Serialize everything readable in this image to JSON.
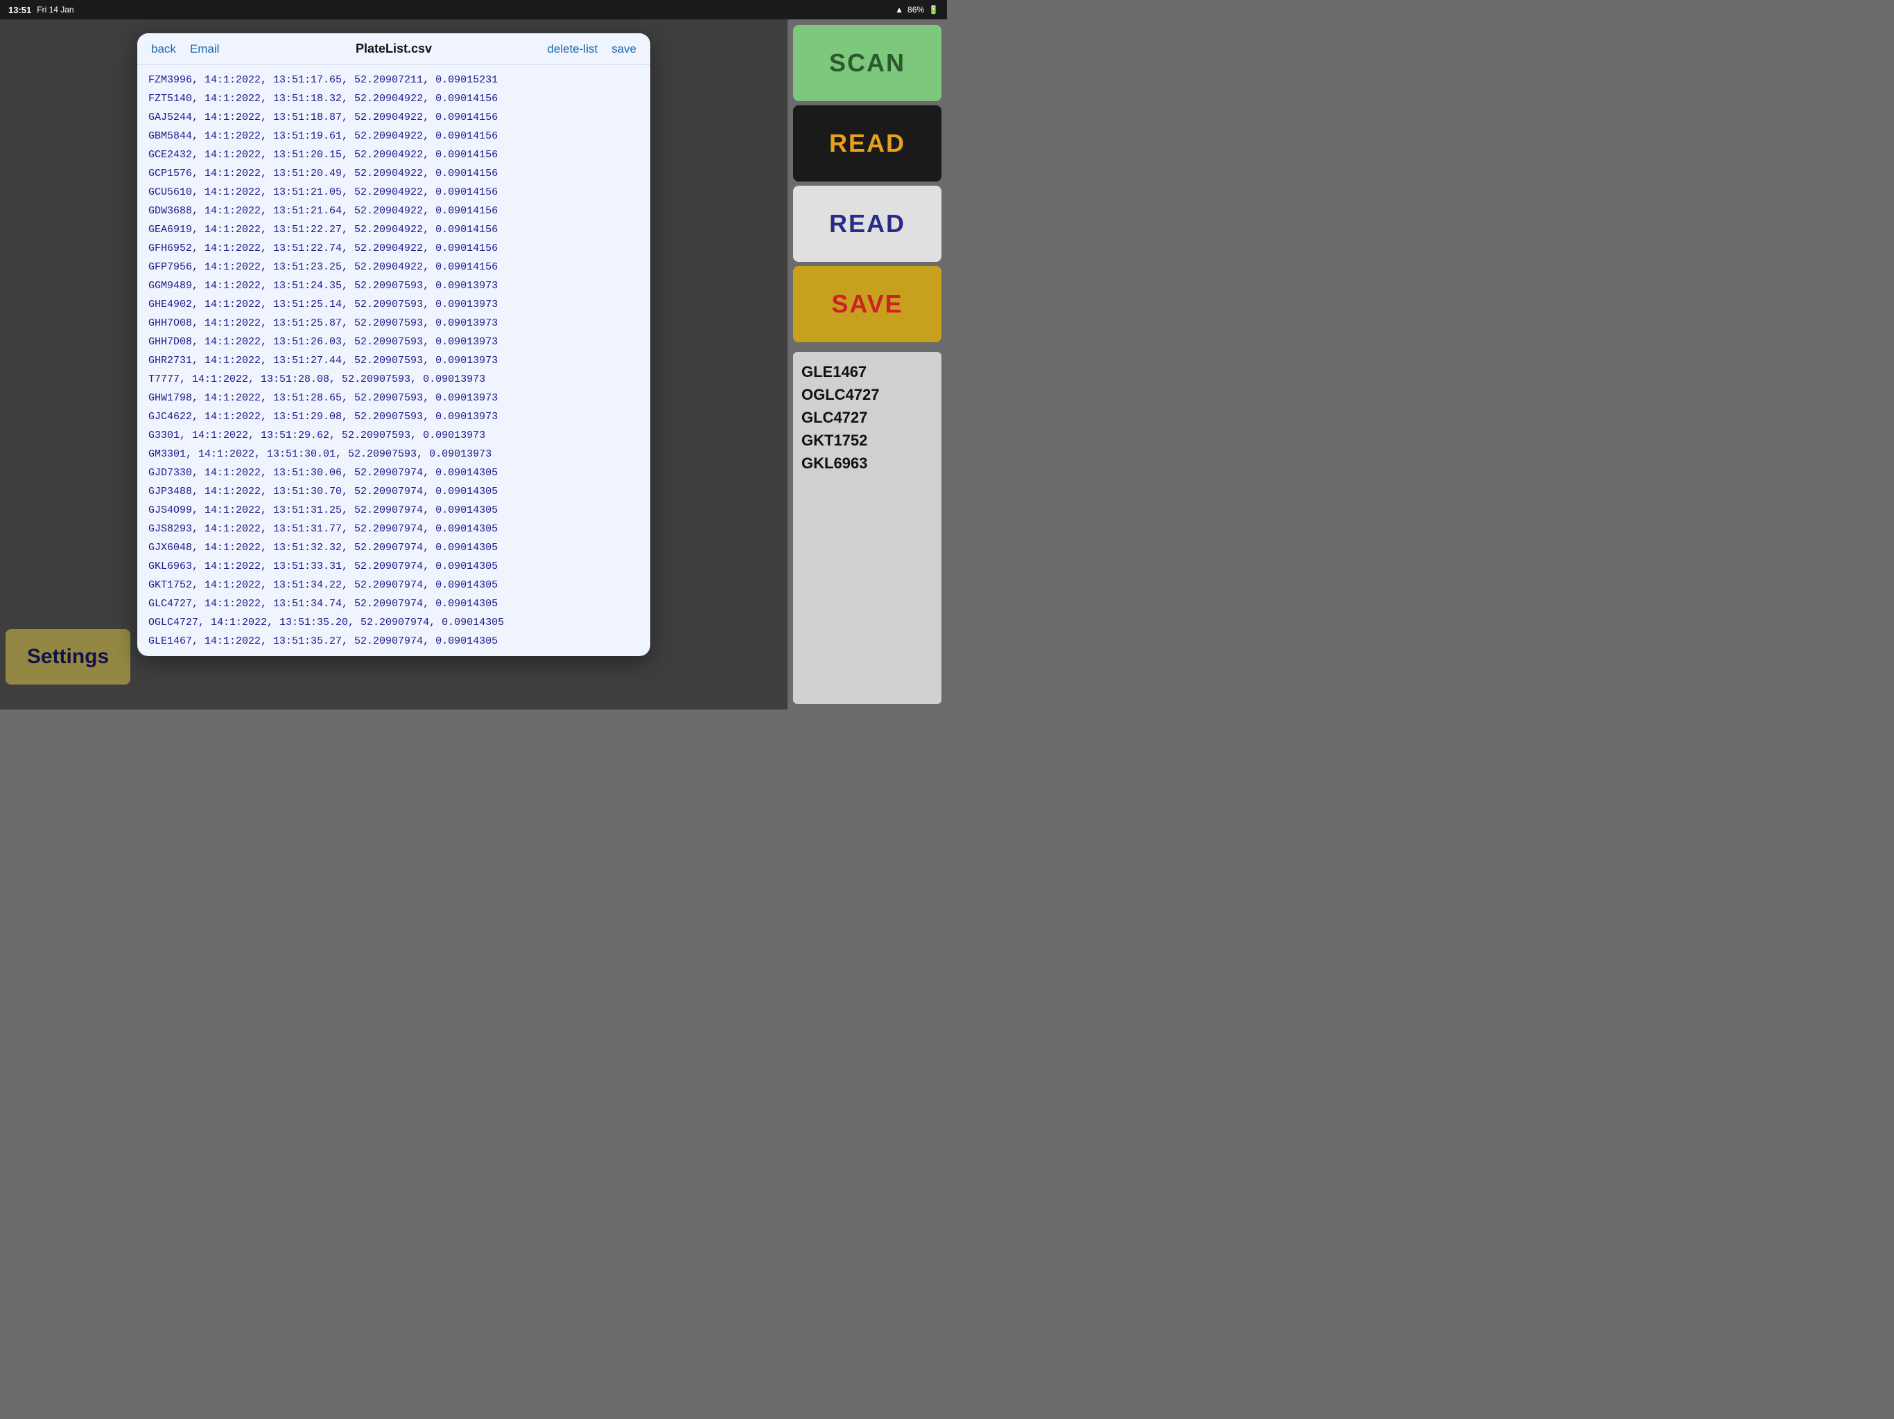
{
  "statusBar": {
    "time": "13:51",
    "date": "Fri 14 Jan",
    "battery": "86%"
  },
  "modal": {
    "title": "PlateList.csv",
    "backLabel": "back",
    "emailLabel": "Email",
    "deleteListLabel": "delete-list",
    "saveLabel": "save",
    "entries": [
      "FZM3996, 14:1:2022, 13:51:17.65, 52.20907211, 0.09015231",
      "FZT5140, 14:1:2022, 13:51:18.32, 52.20904922, 0.09014156",
      "GAJ5244, 14:1:2022, 13:51:18.87, 52.20904922, 0.09014156",
      "GBM5844, 14:1:2022, 13:51:19.61, 52.20904922, 0.09014156",
      "GCE2432, 14:1:2022, 13:51:20.15, 52.20904922, 0.09014156",
      "GCP1576, 14:1:2022, 13:51:20.49, 52.20904922, 0.09014156",
      "GCU5610, 14:1:2022, 13:51:21.05, 52.20904922, 0.09014156",
      "GDW3688, 14:1:2022, 13:51:21.64, 52.20904922, 0.09014156",
      "GEA6919, 14:1:2022, 13:51:22.27, 52.20904922, 0.09014156",
      "GFH6952, 14:1:2022, 13:51:22.74, 52.20904922, 0.09014156",
      "GFP7956, 14:1:2022, 13:51:23.25, 52.20904922, 0.09014156",
      "GGM9489, 14:1:2022, 13:51:24.35, 52.20907593, 0.09013973",
      "GHE4902, 14:1:2022, 13:51:25.14, 52.20907593, 0.09013973",
      "GHH7O08, 14:1:2022, 13:51:25.87, 52.20907593, 0.09013973",
      "GHH7D08, 14:1:2022, 13:51:26.03, 52.20907593, 0.09013973",
      "GHR2731, 14:1:2022, 13:51:27.44, 52.20907593, 0.09013973",
      "T7777, 14:1:2022, 13:51:28.08, 52.20907593, 0.09013973",
      "GHW1798, 14:1:2022, 13:51:28.65, 52.20907593, 0.09013973",
      "GJC4622, 14:1:2022, 13:51:29.08, 52.20907593, 0.09013973",
      "G3301, 14:1:2022, 13:51:29.62, 52.20907593, 0.09013973",
      "GM3301, 14:1:2022, 13:51:30.01, 52.20907593, 0.09013973",
      "GJD7330, 14:1:2022, 13:51:30.06, 52.20907974, 0.09014305",
      "GJP3488, 14:1:2022, 13:51:30.70, 52.20907974, 0.09014305",
      "GJS4O99, 14:1:2022, 13:51:31.25, 52.20907974, 0.09014305",
      "GJS8293, 14:1:2022, 13:51:31.77, 52.20907974, 0.09014305",
      "GJX6048, 14:1:2022, 13:51:32.32, 52.20907974, 0.09014305",
      "GKL6963, 14:1:2022, 13:51:33.31, 52.20907974, 0.09014305",
      "GKT1752, 14:1:2022, 13:51:34.22, 52.20907974, 0.09014305",
      "GLC4727, 14:1:2022, 13:51:34.74, 52.20907974, 0.09014305",
      "OGLC4727, 14:1:2022, 13:51:35.20, 52.20907974, 0.09014305",
      "GLE1467, 14:1:2022, 13:51:35.27, 52.20907974, 0.09014305"
    ]
  },
  "rightPanel": {
    "scanLabel": "SCAN",
    "readBlackLabel": "READ",
    "readWhiteLabel": "READ",
    "saveLabel": "SAVE",
    "recentPlates": [
      "GLE1467",
      "OGLC4727",
      "GLC4727",
      "GKT1752",
      "GKL6963"
    ]
  },
  "settingsLabel": "Settings"
}
